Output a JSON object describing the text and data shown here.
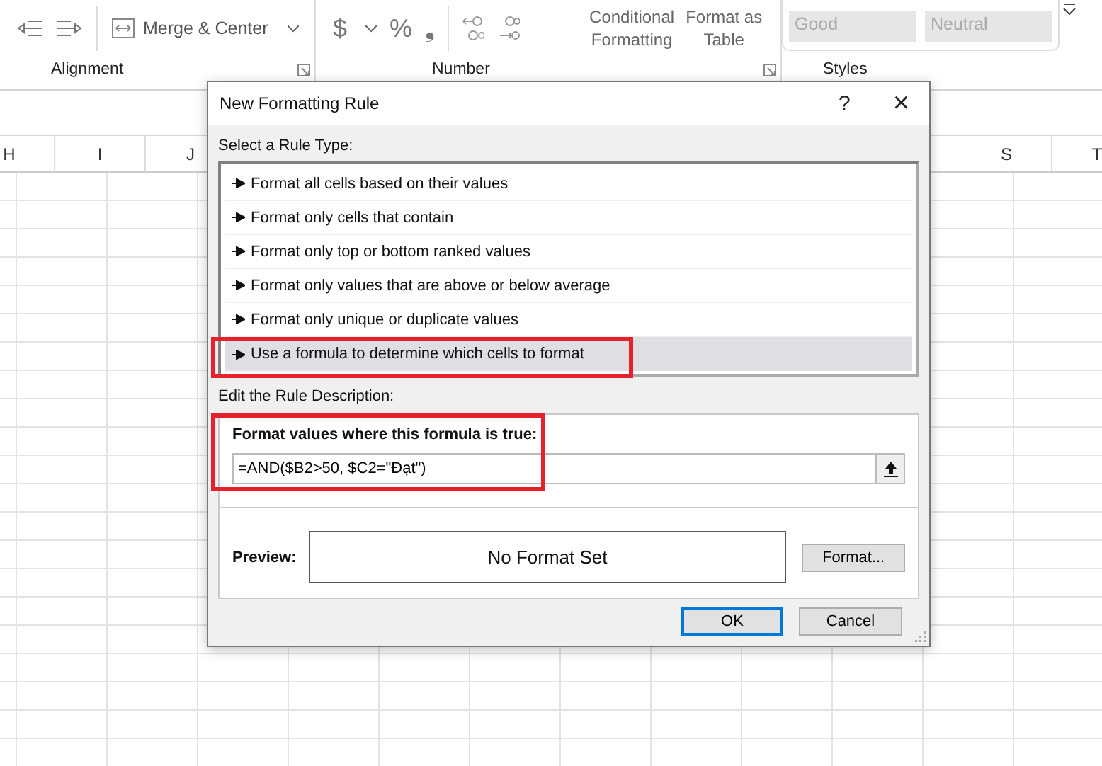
{
  "ribbon": {
    "alignment": {
      "merge_label": "Merge & Center",
      "group_label": "Alignment"
    },
    "number": {
      "currency": "$",
      "percent": "%",
      "comma": "❟",
      "group_label": "Number"
    },
    "styles": {
      "conditional": [
        "Conditional",
        "Formatting"
      ],
      "format_table": [
        "Format as",
        "Table"
      ],
      "cells": [
        "Good",
        "Neutral"
      ],
      "group_label": "Styles"
    }
  },
  "sheet": {
    "columns_left": [
      "H",
      "I",
      "J"
    ],
    "columns_right": [
      "S",
      "T"
    ]
  },
  "dialog": {
    "title": "New Formatting Rule",
    "help": "?",
    "close": "×",
    "rule_type_label": "Select a Rule Type:",
    "rule_types": [
      {
        "label": "Format all cells based on their values",
        "selected": false
      },
      {
        "label": "Format only cells that contain",
        "selected": false
      },
      {
        "label": "Format only top or bottom ranked values",
        "selected": false
      },
      {
        "label": "Format only values that are above or below average",
        "selected": false
      },
      {
        "label": "Format only unique or duplicate values",
        "selected": false
      },
      {
        "label": "Use a formula to determine which cells to format",
        "selected": true
      }
    ],
    "description_label": "Edit the Rule Description:",
    "formula_label": "Format values where this formula is true:",
    "formula": "=AND($B2>50, $C2=\"Đạt\")",
    "preview_label": "Preview:",
    "preview_text": "No Format Set",
    "format_button": "Format...",
    "buttons": [
      "OK",
      "Cancel"
    ]
  }
}
